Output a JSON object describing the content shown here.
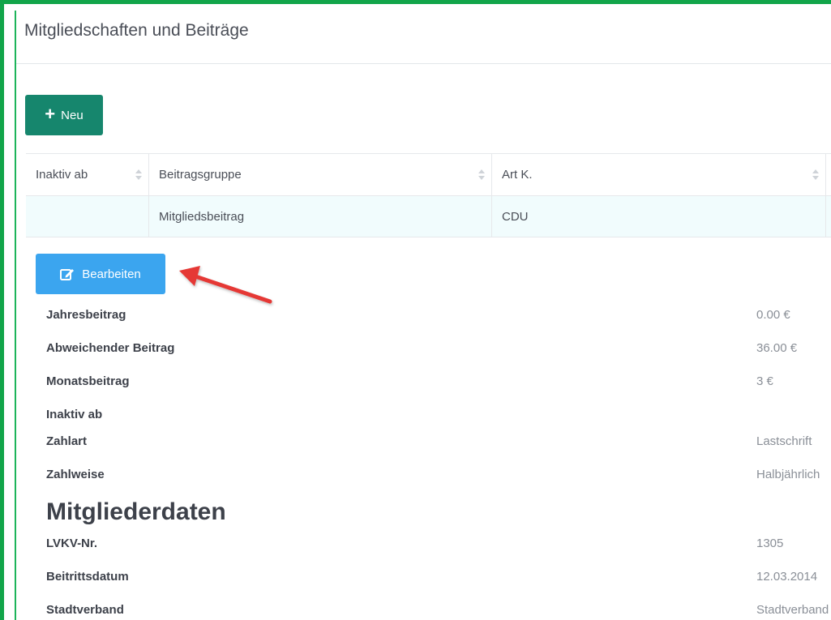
{
  "panel": {
    "title": "Mitgliedschaften und Beiträge"
  },
  "toolbar": {
    "new_label": "Neu",
    "new_icon": "plus-icon"
  },
  "table": {
    "columns": [
      "Inaktiv ab",
      "Beitragsgruppe",
      "Art K.",
      ""
    ],
    "rows": [
      [
        "",
        "Mitgliedsbeitrag",
        "CDU",
        ""
      ]
    ]
  },
  "edit": {
    "label": "Bearbeiten",
    "icon": "edit-icon"
  },
  "annotation": {
    "arrow_color": "#e53935"
  },
  "details": [
    {
      "label": "Jahresbeitrag",
      "value": "0.00 €"
    },
    {
      "label": "Abweichender Beitrag",
      "value": "36.00 €"
    },
    {
      "label": "Monatsbeitrag",
      "value": "3 €"
    },
    {
      "label": "Inaktiv ab",
      "value": ""
    },
    {
      "label": "Zahlart",
      "value": "Lastschrift"
    },
    {
      "label": "Zahlweise",
      "value": "Halbjährlich"
    }
  ],
  "member_section": {
    "title": "Mitgliederdaten",
    "fields": [
      {
        "label": "LVKV-Nr.",
        "value": "1305"
      },
      {
        "label": "Beitrittsdatum",
        "value": "12.03.2014"
      },
      {
        "label": "Stadtverband",
        "value": "Stadtverband"
      }
    ]
  },
  "colors": {
    "frame": "#12a54a",
    "primary": "#16866d",
    "info": "#3ba5ef",
    "row_highlight": "#f1fcfd"
  }
}
